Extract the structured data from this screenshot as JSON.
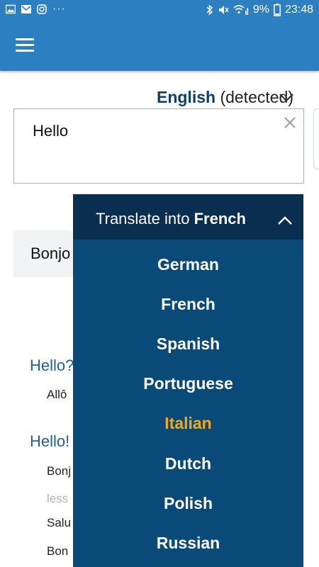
{
  "status_bar": {
    "dots": "···",
    "battery": "9%",
    "time": "23:48"
  },
  "app_bar": {
    "menu_icon": "hamburger-menu-icon"
  },
  "source": {
    "language": "English",
    "detected": "(detected)",
    "input_value": "Hello"
  },
  "result": {
    "text": "Bonjo"
  },
  "dictionary": [
    {
      "head": "Hello?",
      "items": [
        "Allô"
      ]
    },
    {
      "head": "Hello!",
      "items": [
        "Bonj"
      ],
      "less": "less",
      "more_items": [
        "Salu",
        "Bon"
      ]
    }
  ],
  "dropdown": {
    "title_prefix": "Translate into",
    "title_language": "French",
    "languages": [
      "German",
      "French",
      "Spanish",
      "Portuguese",
      "Italian",
      "Dutch",
      "Polish",
      "Russian"
    ],
    "highlighted": "Italian",
    "highlight_color": "#f0a81c"
  },
  "colors": {
    "primary": "#2c7fc0",
    "dropdown_bg": "#0a4a79",
    "dropdown_header": "#0a2e4f"
  }
}
